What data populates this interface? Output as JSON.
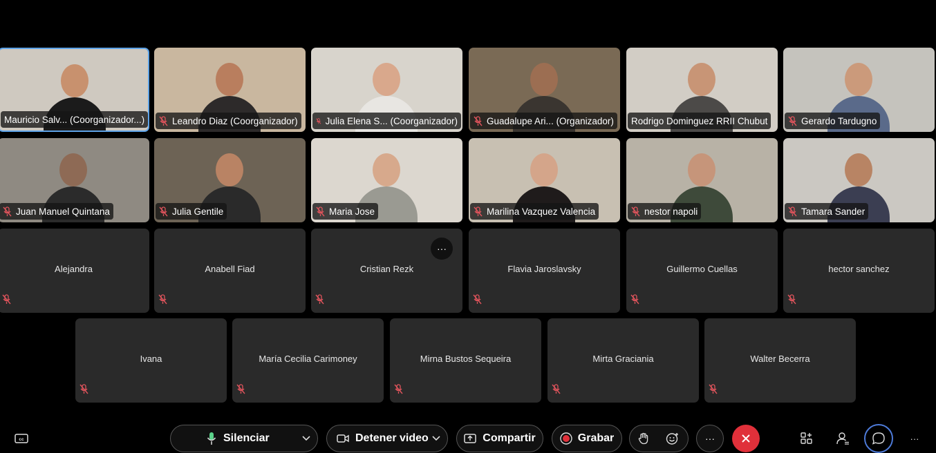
{
  "video_participants": [
    {
      "name": "Mauricio  Salv... (Coorganizador...)",
      "muted": false,
      "active": true,
      "bg": "#cfc9c0",
      "skin": "#c8916e",
      "shirt": "#1b1b1b"
    },
    {
      "name": "Leandro Diaz (Coorganizador)",
      "muted": true,
      "active": false,
      "bg": "#c9b79f",
      "skin": "#b97e5e",
      "shirt": "#2d2a2a"
    },
    {
      "name": "Julia Elena S... (Coorganizador)",
      "muted": true,
      "active": false,
      "bg": "#d8d4cc",
      "skin": "#d9a88c",
      "shirt": "#e8e6e2"
    },
    {
      "name": "Guadalupe Ari... (Organizador)",
      "muted": true,
      "active": false,
      "bg": "#7a6a55",
      "skin": "#9c6e52",
      "shirt": "#3a3530"
    },
    {
      "name": "Rodrigo Dominguez RRII Chubut",
      "muted": false,
      "active": false,
      "bg": "#d2cdc5",
      "skin": "#c89576",
      "shirt": "#4c4a48"
    },
    {
      "name": "Gerardo Tardugno",
      "muted": true,
      "active": false,
      "bg": "#c5c3bd",
      "skin": "#cb9a7b",
      "shirt": "#5a6a8a"
    },
    {
      "name": "Juan Manuel Quintana",
      "muted": true,
      "active": false,
      "bg": "#8f8a82",
      "skin": "#8e6a55",
      "shirt": "#2b2b2b"
    },
    {
      "name": "Julia Gentile",
      "muted": true,
      "active": false,
      "bg": "#6d6355",
      "skin": "#b98364",
      "shirt": "#2a2a2a"
    },
    {
      "name": "Maria Jose",
      "muted": true,
      "active": false,
      "bg": "#dcd7cf",
      "skin": "#d7a98c",
      "shirt": "#9a9a92"
    },
    {
      "name": "Marilina Vazquez Valencia",
      "muted": true,
      "active": false,
      "bg": "#c8c0b2",
      "skin": "#d4a58a",
      "shirt": "#1f1b1b"
    },
    {
      "name": "nestor napoli",
      "muted": true,
      "active": false,
      "bg": "#b8b2a6",
      "skin": "#c6957a",
      "shirt": "#3e4a3a"
    },
    {
      "name": "Tamara Sander",
      "muted": true,
      "active": false,
      "bg": "#cbc8c2",
      "skin": "#b88464",
      "shirt": "#3b3e52"
    }
  ],
  "name_participants_row3": [
    {
      "name": "Alejandra"
    },
    {
      "name": "Anabell Fiad"
    },
    {
      "name": "Cristian Rezk",
      "more": "···"
    },
    {
      "name": "Flavia Jaroslavsky"
    },
    {
      "name": "Guillermo Cuellas"
    },
    {
      "name": "hector sanchez"
    }
  ],
  "name_participants_row4": [
    {
      "name": "Ivana"
    },
    {
      "name": "María Cecilia Carimoney"
    },
    {
      "name": "Mirna Bustos Sequeira"
    },
    {
      "name": "Mirta Graciania"
    },
    {
      "name": "Walter Becerra"
    }
  ],
  "controls": {
    "mute_label": "Silenciar",
    "video_label": "Detener video",
    "share_label": "Compartir",
    "record_label": "Grabar",
    "more_label": "···",
    "overflow_label": "···"
  },
  "colors": {
    "mute_red": "#e0545c",
    "end_red": "#e0303a",
    "active_border": "#5ea3e8",
    "mic_green": "#5bd28a",
    "record_red": "#e0303a",
    "chat_ring": "#4d7ad8"
  },
  "icons": [
    "captions-icon",
    "microphone-icon",
    "chevron-down-icon",
    "video-camera-icon",
    "share-screen-icon",
    "record-icon",
    "raise-hand-icon",
    "reactions-icon",
    "more-icon",
    "end-call-icon",
    "apps-icon",
    "participants-icon",
    "chat-icon",
    "overflow-icon",
    "muted-mic-icon"
  ]
}
